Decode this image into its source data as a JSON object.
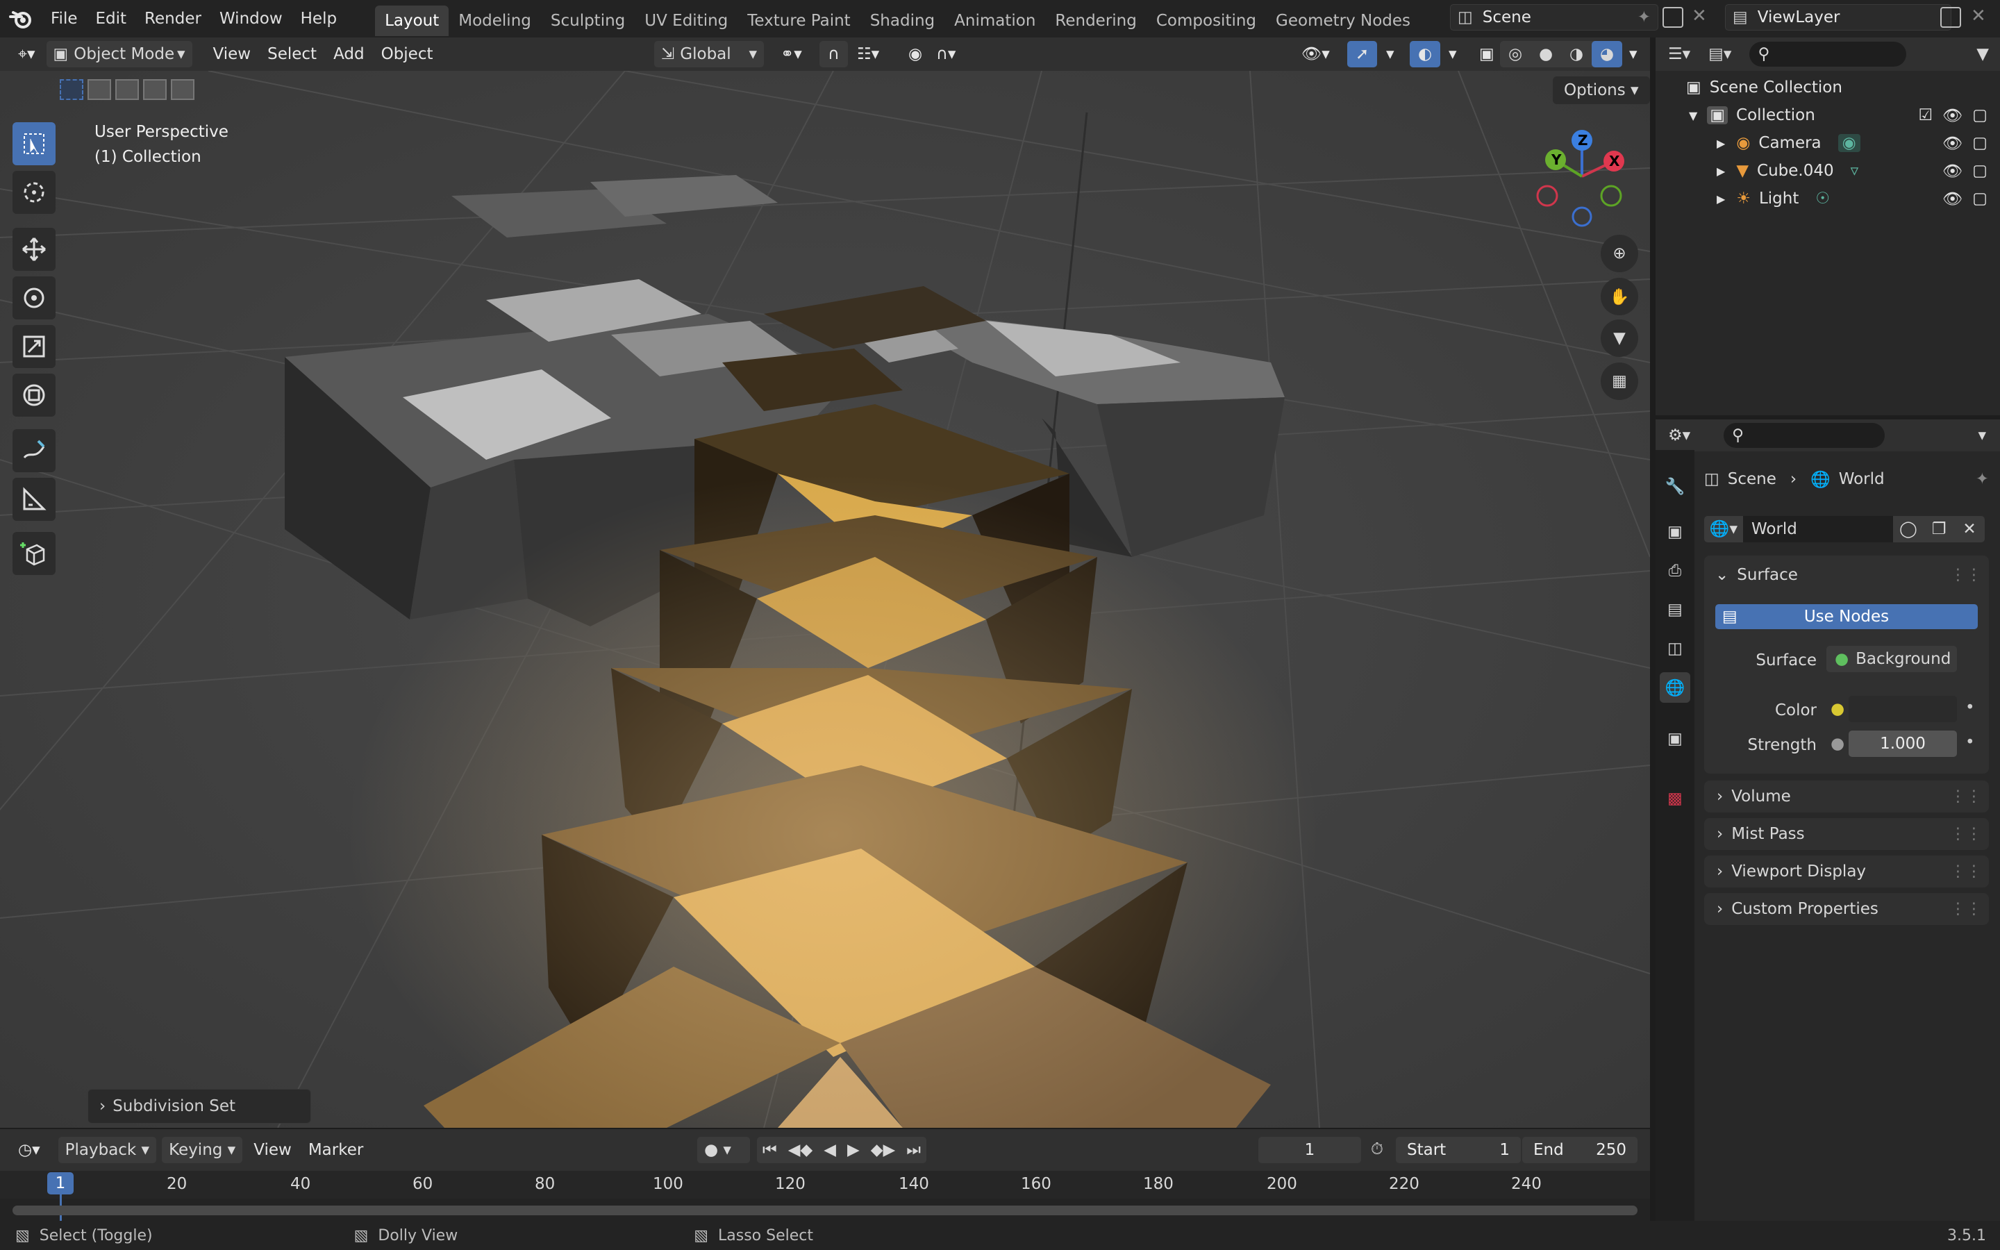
{
  "menu": {
    "items": [
      "File",
      "Edit",
      "Render",
      "Window",
      "Help"
    ],
    "workspaces": [
      "Layout",
      "Modeling",
      "Sculpting",
      "UV Editing",
      "Texture Paint",
      "Shading",
      "Animation",
      "Rendering",
      "Compositing",
      "Geometry Nodes"
    ],
    "active_workspace": "Layout",
    "scene": "Scene",
    "view_layer": "ViewLayer"
  },
  "viewport_header": {
    "mode": "Object Mode",
    "menus": [
      "View",
      "Select",
      "Add",
      "Object"
    ],
    "orientation": "Global",
    "options": "Options"
  },
  "viewport": {
    "view_name": "User Perspective",
    "collection_label": "(1) Collection",
    "operator_panel": "Subdivision Set",
    "gizmo_axes": [
      "Z",
      "Y",
      "X"
    ]
  },
  "timeline": {
    "menus": [
      "Playback",
      "Keying",
      "View",
      "Marker"
    ],
    "current_frame": "1",
    "start_label": "Start",
    "start": "1",
    "end_label": "End",
    "end": "250",
    "ruler": [
      "1",
      "20",
      "40",
      "60",
      "80",
      "100",
      "120",
      "140",
      "160",
      "180",
      "200",
      "220",
      "240"
    ]
  },
  "status": {
    "left": "Select (Toggle)",
    "middle": "Dolly View",
    "right": "Lasso Select",
    "version": "3.5.1"
  },
  "outliner": {
    "root": "Scene Collection",
    "collection": "Collection",
    "items": [
      {
        "name": "Camera",
        "icon": "camera-icon"
      },
      {
        "name": "Cube.040",
        "icon": "mesh-icon"
      },
      {
        "name": "Light",
        "icon": "light-icon"
      }
    ]
  },
  "properties": {
    "breadcrumb_scene": "Scene",
    "breadcrumb_world": "World",
    "world_name": "World",
    "surface_panel": "Surface",
    "use_nodes": "Use Nodes",
    "surface_label": "Surface",
    "surface_value": "Background",
    "color_label": "Color",
    "strength_label": "Strength",
    "strength_value": "1.000",
    "collapsed_panels": [
      "Volume",
      "Mist Pass",
      "Viewport Display",
      "Custom Properties"
    ]
  },
  "colors": {
    "accent": "#4772b3",
    "selection_orange": "#f5a030"
  }
}
